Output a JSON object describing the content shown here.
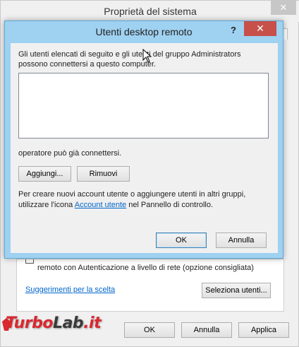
{
  "system_properties": {
    "title": "Proprietà del sistema",
    "close_glyph": "✕",
    "nla_option": "remoto con Autenticazione a livello di rete (opzione consigliata)",
    "help_link": "Suggerimenti per la scelta",
    "select_users_button": "Seleziona utenti...",
    "footer": {
      "ok": "OK",
      "cancel": "Annulla",
      "apply": "Applica"
    }
  },
  "remote_users_dialog": {
    "title": "Utenti desktop remoto",
    "help_glyph": "?",
    "close_glyph": "✕",
    "description": "Gli utenti elencati di seguito e gli utenti del gruppo Administrators possono connettersi a questo computer.",
    "users": [],
    "operator_note": "operatore può già connettersi.",
    "add_button": "Aggiungi...",
    "remove_button": "Rimuovi",
    "info_prefix": "Per creare nuovi account utente o aggiungere utenti in altri gruppi, utilizzare l'icona ",
    "info_link": "Account utente",
    "info_suffix": " nel Pannello di controllo.",
    "ok_button": "OK",
    "cancel_button": "Annulla"
  },
  "watermark": {
    "part1": "Turbo",
    "part2": "Lab",
    "part3": ".it"
  },
  "colors": {
    "dialog_frame": "#9fd1f1",
    "close_button": "#c7504a",
    "link": "#0066cc"
  }
}
